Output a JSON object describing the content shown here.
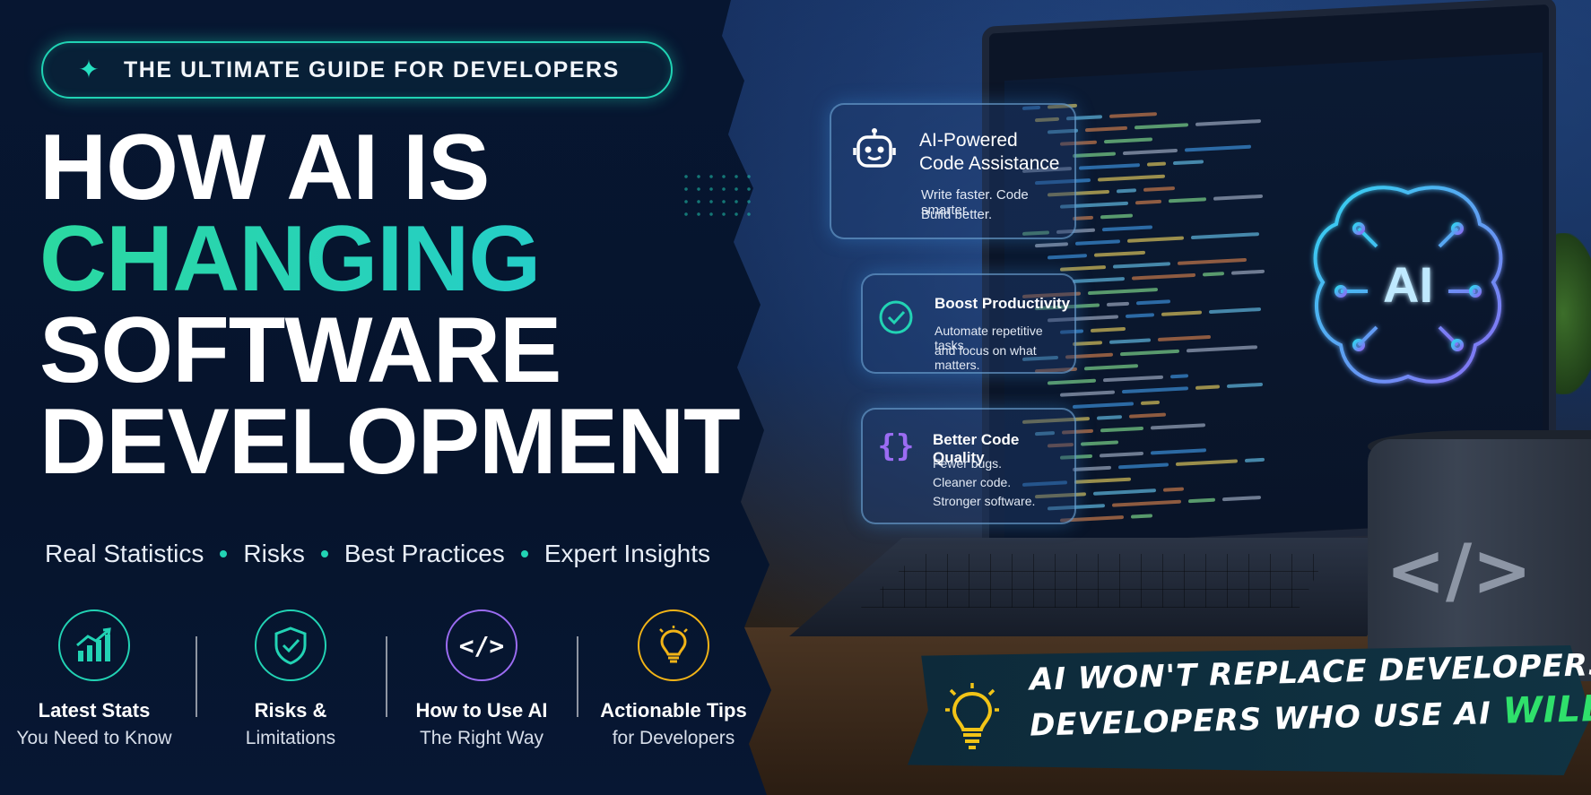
{
  "badge": {
    "icon": "sparkle-icon",
    "text": "THE ULTIMATE GUIDE FOR DEVELOPERS"
  },
  "headline": {
    "line1": "HOW AI IS",
    "line2": "CHANGING",
    "line3": "SOFTWARE",
    "line4": "DEVELOPMENT"
  },
  "subtitle": {
    "items": [
      "Real Statistics",
      "Risks",
      "Best Practices",
      "Expert Insights"
    ]
  },
  "features": [
    {
      "icon": "chart-growth-icon",
      "title": "Latest Stats",
      "subtitle": "You Need to Know",
      "color": "#22d3b4"
    },
    {
      "icon": "shield-check-icon",
      "title": "Risks &",
      "subtitle": "Limitations",
      "color": "#22d3b4"
    },
    {
      "icon": "code-icon",
      "title": "How to Use AI",
      "subtitle": "The Right Way",
      "color": "#9b6cf2"
    },
    {
      "icon": "lightbulb-icon",
      "title": "Actionable Tips",
      "subtitle": "for Developers",
      "color": "#f2b417"
    }
  ],
  "cards": [
    {
      "icon": "robot-icon",
      "title_line1": "AI-Powered",
      "title_line2": "Code Assistance",
      "desc_line1": "Write faster. Code smarter.",
      "desc_line2": "Build better."
    },
    {
      "icon": "check-circle-icon",
      "title_line1": "Boost Productivity",
      "desc_line1": "Automate repetitive tasks",
      "desc_line2": "and focus on what matters."
    },
    {
      "icon": "braces-icon",
      "title_line1": "Better Code Quality",
      "desc_line1": "Fewer bugs.",
      "desc_line2": "Cleaner code.",
      "desc_line3": "Stronger software."
    }
  ],
  "screen": {
    "brain_label": "AI"
  },
  "mug": {
    "symbol": "</>"
  },
  "quote": {
    "line1": "AI WON'T REPLACE DEVELOPERS.",
    "line2_prefix": "DEVELOPERS WHO USE AI",
    "line2_highlight": "WILL."
  },
  "colors": {
    "accent_teal": "#22d3b4",
    "accent_purple": "#9b6cf2",
    "accent_yellow": "#f2b417",
    "accent_green": "#2fe06b",
    "background": "#07142b"
  }
}
